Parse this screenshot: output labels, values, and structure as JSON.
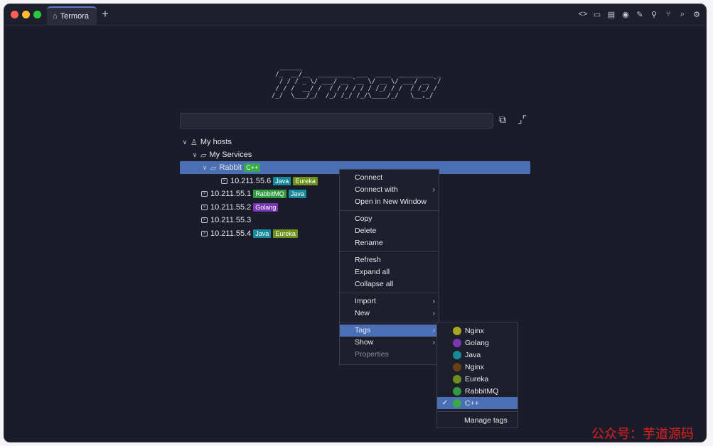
{
  "window": {
    "tab_title": "Termora",
    "new_tab": "+"
  },
  "toolbar": {
    "icons": [
      "code-icon",
      "folder-icon",
      "notes-icon",
      "record-icon",
      "pen-icon",
      "pin-icon",
      "git-branch-icon",
      "search-icon",
      "gear-icon"
    ]
  },
  "banner": {
    "ascii": "  ______\n /_  __/__  _________ ___  ____  _________ _\n  / / / _ \\/ ___/ __ `__ \\/ __ \\/ ___/ __ `/\n / / /  __/ /  / / / / / / /_/ / /  / /_/ /\n/_/  \\___/_/  /_/ /_/ /_/\\____/_/   \\__,_/"
  },
  "search": {
    "value": "",
    "placeholder": ""
  },
  "tree": {
    "root": "My hosts",
    "folder": "My Services",
    "subfolder": "Rabbit",
    "subfolder_tag": "C++",
    "hosts": [
      {
        "label": "10.211.55.6",
        "tags": [
          "Java",
          "Eureka"
        ]
      },
      {
        "label": "10.211.55.1",
        "tags": [
          "RabbitMQ",
          "Java"
        ]
      },
      {
        "label": "10.211.55.2",
        "tags": [
          "Golang"
        ]
      },
      {
        "label": "10.211.55.3",
        "tags": []
      },
      {
        "label": "10.211.55.4",
        "tags": [
          "Java",
          "Eureka"
        ]
      }
    ]
  },
  "tag_colors": {
    "C++": "#3aa94a",
    "Java": "#16899a",
    "Eureka": "#6f8f1c",
    "RabbitMQ": "#2f9a3e",
    "Golang": "#7a36b3"
  },
  "context_menu": {
    "connect": "Connect",
    "connect_with": "Connect with",
    "open_new_window": "Open in New Window",
    "copy": "Copy",
    "delete": "Delete",
    "rename": "Rename",
    "refresh": "Refresh",
    "expand_all": "Expand all",
    "collapse_all": "Collapse all",
    "import": "Import",
    "new": "New",
    "tags": "Tags",
    "show": "Show",
    "properties": "Properties"
  },
  "tags_submenu": {
    "items": [
      {
        "label": "Nginx",
        "color": "#a8a520",
        "checked": false
      },
      {
        "label": "Golang",
        "color": "#7a36b3",
        "checked": false
      },
      {
        "label": "Java",
        "color": "#16899a",
        "checked": false
      },
      {
        "label": "Nginx",
        "color": "#6b3f14",
        "checked": false
      },
      {
        "label": "Eureka",
        "color": "#6f8f1c",
        "checked": false
      },
      {
        "label": "RabbitMQ",
        "color": "#2f9a3e",
        "checked": false
      },
      {
        "label": "C++",
        "color": "#3aa94a",
        "checked": true
      }
    ],
    "checkmark": "✓",
    "manage": "Manage tags"
  },
  "watermark": "公众号：芋道源码"
}
